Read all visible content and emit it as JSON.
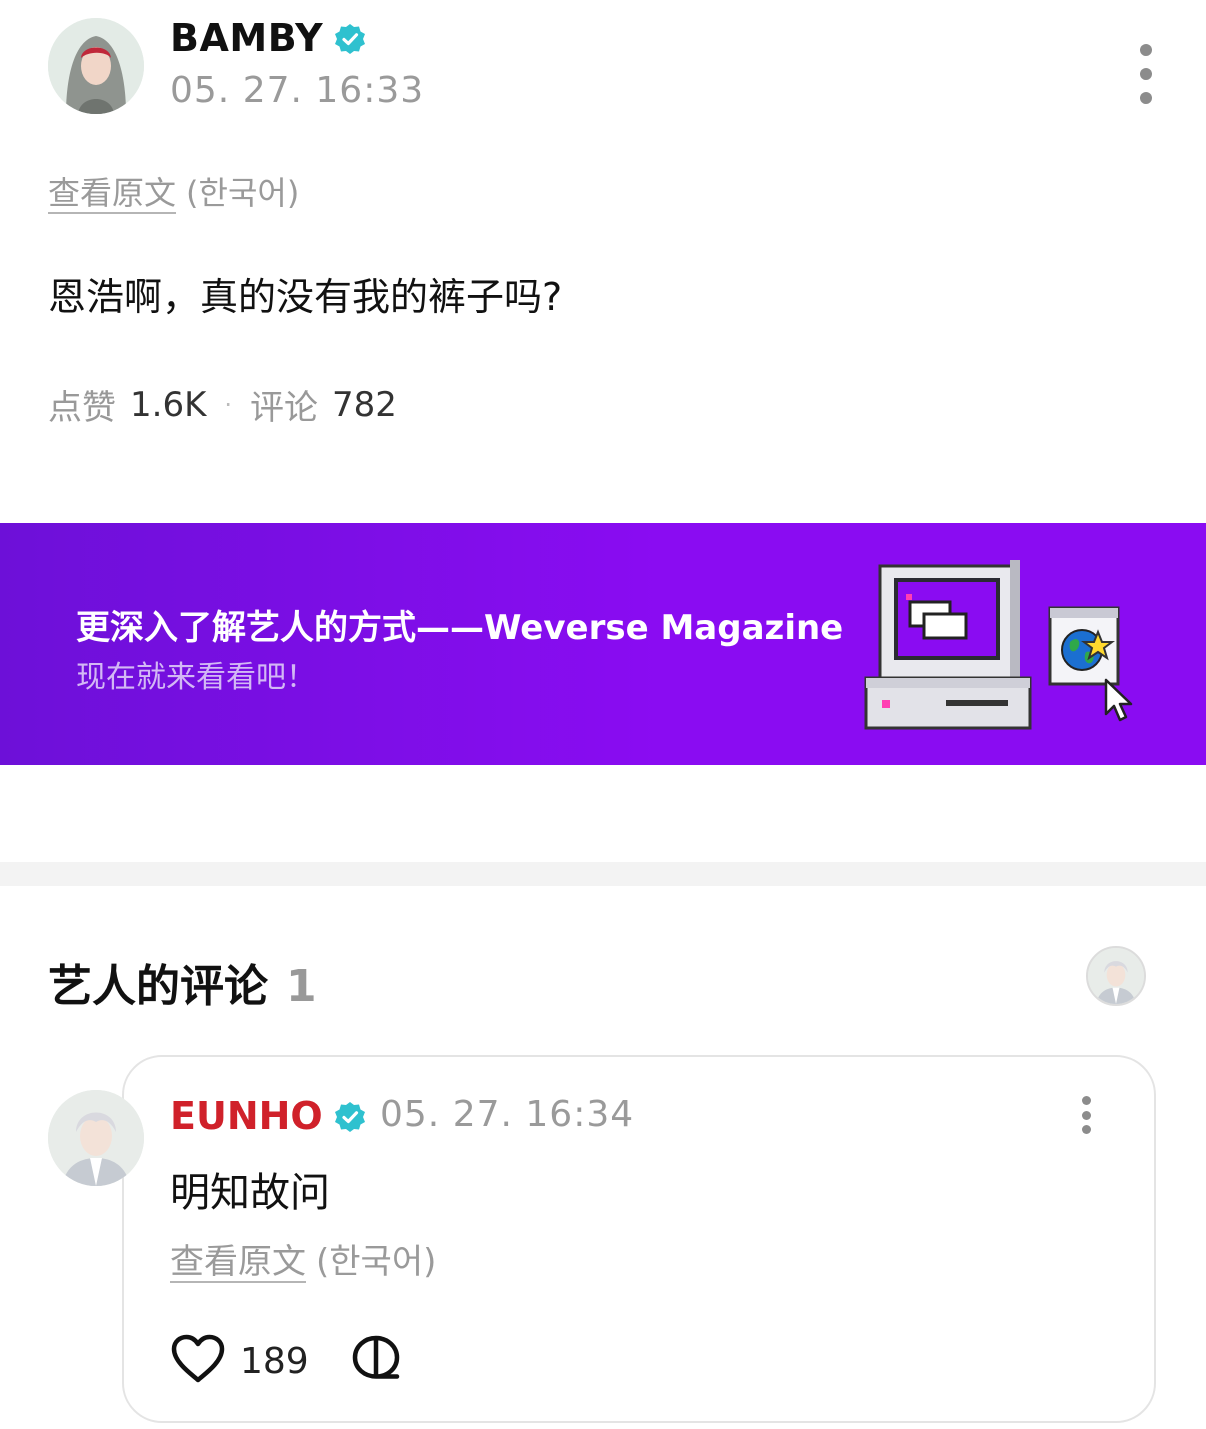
{
  "post": {
    "author": "BAMBY",
    "time": "05. 27. 16:33",
    "translate_link": "查看原文",
    "translate_lang": "(한국어)",
    "body": "恩浩啊，真的没有我的裤子吗?",
    "likes_label": "点赞",
    "likes_count": "1.6K",
    "separator": "·",
    "comments_label": "评论",
    "comments_count": "782"
  },
  "banner": {
    "title": "更深入了解艺人的方式——Weverse Magazine",
    "subtitle": "现在就来看看吧！"
  },
  "artist_comments": {
    "title": "艺人的评论",
    "count": "1",
    "comment": {
      "author": "EUNHO",
      "time": "05. 27. 16:34",
      "body": "明知故问",
      "translate_link": "查看原文",
      "translate_lang": "(한국어)",
      "likes": "189"
    }
  },
  "colors": {
    "verified": "#2fc1cf",
    "banner_purple": "#8a0cf2",
    "artist_name_red": "#d0212a"
  },
  "icons": [
    "verified-badge-icon",
    "more-options-icon",
    "heart-icon",
    "comment-bubble-icon",
    "retro-computer-illustration"
  ]
}
